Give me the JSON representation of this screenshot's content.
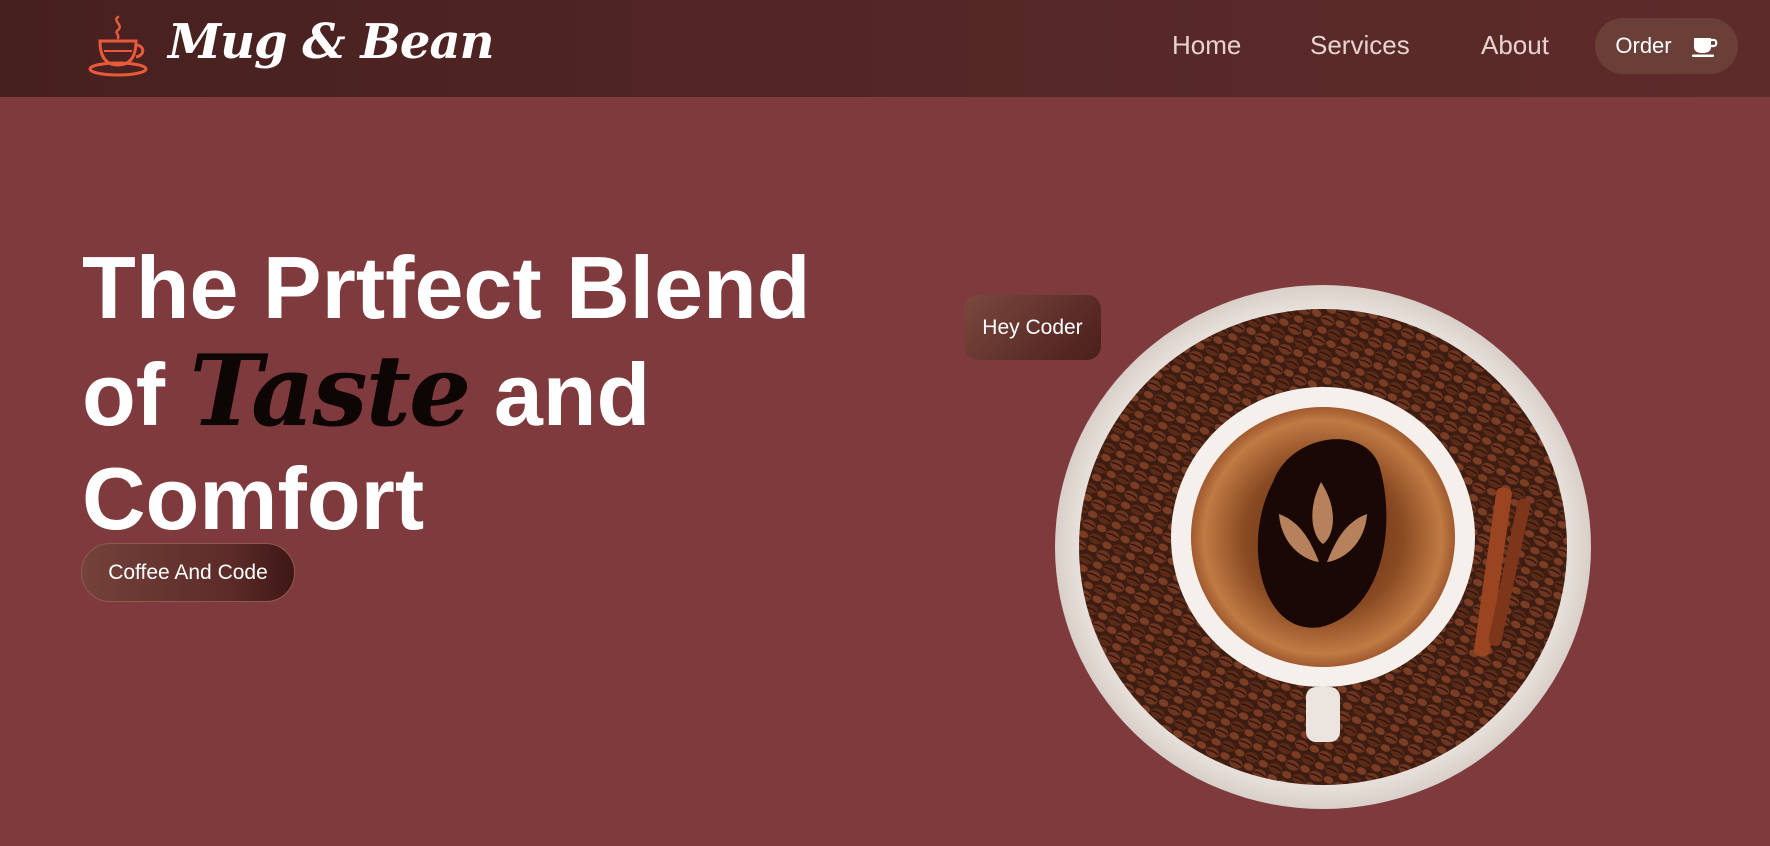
{
  "brand": {
    "name": "Mug & Bean",
    "logo_icon": "coffee-cup-steam-icon"
  },
  "nav": {
    "links": [
      {
        "label": "Home"
      },
      {
        "label": "Services"
      },
      {
        "label": "About"
      }
    ],
    "order": {
      "label": "Order",
      "icon": "coffee-cup-icon"
    }
  },
  "hero": {
    "line1": "The Prtfect Blend",
    "line2_prefix": "of",
    "line2_script": "Taste",
    "line2_suffix": "and",
    "line3": "Comfort",
    "cta_label": "Coffee And Code",
    "tag_label": "Hey Coder",
    "image_icon": "coffee-cup-on-beans-image"
  },
  "colors": {
    "background": "#7f3a3e",
    "navbar": "#4d2423",
    "button": "#6a3f38",
    "logo_accent": "#e85a3a"
  }
}
